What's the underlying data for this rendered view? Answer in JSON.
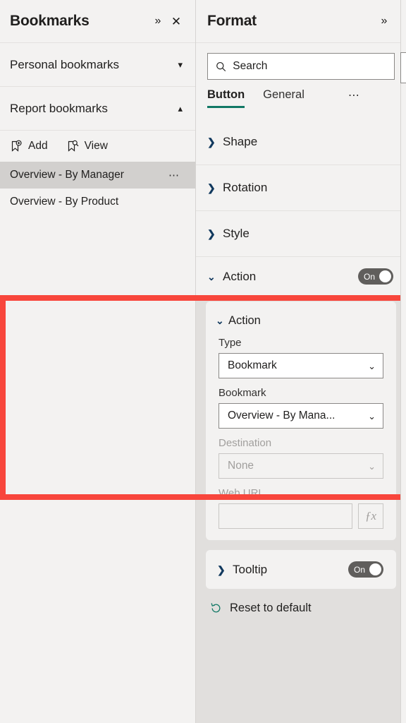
{
  "bookmarks_pane": {
    "title": "Bookmarks",
    "expand_icon": "chevron-double-right-icon",
    "close_icon": "close-icon",
    "sections": [
      {
        "label": "Personal bookmarks",
        "caret": "chevron-down-icon",
        "expanded": false
      },
      {
        "label": "Report bookmarks",
        "caret": "chevron-up-icon",
        "expanded": true
      }
    ],
    "toolbar": [
      {
        "label": "Add",
        "icon": "bookmark-add-icon"
      },
      {
        "label": "View",
        "icon": "bookmark-view-icon"
      }
    ],
    "items": [
      {
        "label": "Overview - By Manager",
        "selected": true,
        "overflow": "…"
      },
      {
        "label": "Overview - By Product",
        "selected": false,
        "overflow": ""
      }
    ]
  },
  "format_pane": {
    "title": "Format",
    "expand_icon": "chevron-double-right-icon",
    "search": {
      "placeholder": "Search",
      "value": "",
      "icon": "search-icon"
    },
    "tabs": [
      {
        "label": "Button",
        "active": true
      },
      {
        "label": "General",
        "active": false
      }
    ],
    "tabs_overflow": "⋯",
    "collapsed_sections": [
      {
        "label": "Shape",
        "caret": "chevron-right-icon"
      },
      {
        "label": "Rotation",
        "caret": "chevron-right-icon"
      },
      {
        "label": "Style",
        "caret": "chevron-right-icon"
      }
    ],
    "action_section": {
      "label": "Action",
      "caret": "chevron-down-icon",
      "toggle": {
        "state_label": "On",
        "on": true
      },
      "card": {
        "title": "Action",
        "caret": "chevron-down-icon",
        "fields": [
          {
            "label": "Type",
            "value": "Bookmark",
            "disabled": false,
            "caret": "chevron-down-icon"
          },
          {
            "label": "Bookmark",
            "value": "Overview - By Mana...",
            "disabled": false,
            "caret": "chevron-down-icon"
          },
          {
            "label": "Destination",
            "value": "None",
            "disabled": true,
            "caret": "chevron-down-icon"
          }
        ],
        "weburl": {
          "label": "Web URL",
          "value": "",
          "disabled": true,
          "fx_label": "ƒx",
          "fx_icon": "function-icon"
        }
      }
    },
    "tooltip_section": {
      "label": "Tooltip",
      "caret": "chevron-right-icon",
      "toggle": {
        "state_label": "On",
        "on": true
      }
    },
    "reset": {
      "label": "Reset to default",
      "icon": "undo-icon"
    }
  },
  "colors": {
    "highlight_border": "#f8463c",
    "tab_underline": "#117865",
    "toggle_on": "#605e5c",
    "pane_bg": "#f3f2f1",
    "format_bg": "#e1dfdd",
    "selected_row": "#d2d0ce"
  }
}
